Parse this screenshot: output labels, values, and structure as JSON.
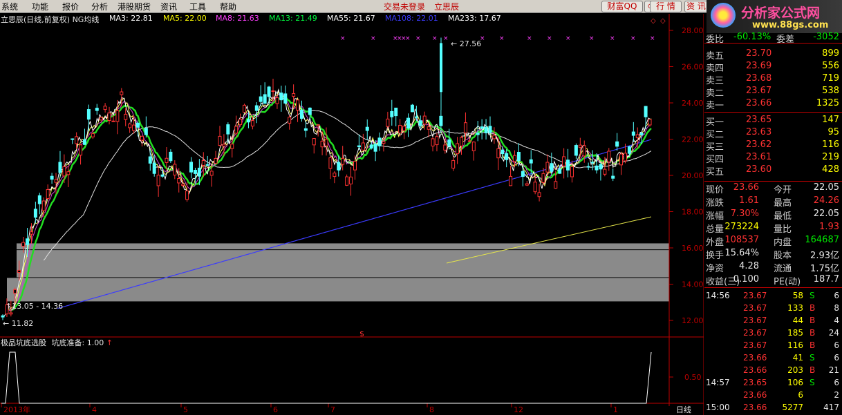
{
  "menu": [
    "系统",
    "功能",
    "报价",
    "分析",
    "港股期货",
    "资讯",
    "工具",
    "帮助"
  ],
  "status_links": [
    "交易未登录",
    "立思辰"
  ],
  "title_buttons": [
    "财富QQ",
    "行 情",
    "资 讯"
  ],
  "logo": {
    "name": "分析家公式网",
    "url": "www.88gs.com"
  },
  "ma_header": {
    "title": "立思辰(日线,前复权) NG均线",
    "items": [
      {
        "label": "MA3: 22.81",
        "color": "#ffffff"
      },
      {
        "label": "MA5: 22.00",
        "color": "#ffff00"
      },
      {
        "label": "MA8: 21.63",
        "color": "#ff40ff"
      },
      {
        "label": "MA13: 21.49",
        "color": "#00ff40"
      },
      {
        "label": "MA55: 21.67",
        "color": "#ffffff"
      },
      {
        "label": "MA108: 22.01",
        "color": "#3b3bff"
      },
      {
        "label": "MA233: 17.67",
        "color": "#ffffff"
      }
    ]
  },
  "indicator": {
    "title": "极品坑底选股",
    "param": "坑底准备: 1.00",
    "scale": "0.50"
  },
  "chart_data": {
    "type": "candlestick",
    "ylim": [
      11,
      28.5
    ],
    "y_ticks": [
      "28.00",
      "26.00",
      "24.00",
      "22.00",
      "20.00",
      "18.00",
      "16.00",
      "14.00",
      "12.00"
    ],
    "x_labels": [
      "2013年",
      "4",
      "5",
      "6",
      "7",
      "8",
      "12",
      "1"
    ],
    "period_label": "日线",
    "annotations": {
      "high": "27.56",
      "low": "11.82",
      "range": "13.05 - 14.36"
    },
    "bands": [
      {
        "from": 13.05,
        "to": 14.36
      },
      {
        "from": 14.36,
        "to": 16.25
      }
    ]
  },
  "panel": {
    "top": [
      {
        "label": "委比",
        "value": "-60.13%",
        "label2": "委差",
        "value2": "-3052"
      }
    ],
    "sells": [
      {
        "label": "卖五",
        "price": "23.70",
        "vol": "899"
      },
      {
        "label": "卖四",
        "price": "23.69",
        "vol": "556"
      },
      {
        "label": "卖三",
        "price": "23.68",
        "vol": "719"
      },
      {
        "label": "卖二",
        "price": "23.67",
        "vol": "538"
      },
      {
        "label": "卖一",
        "price": "23.66",
        "vol": "1325"
      }
    ],
    "buys": [
      {
        "label": "买一",
        "price": "23.65",
        "vol": "147"
      },
      {
        "label": "买二",
        "price": "23.63",
        "vol": "95"
      },
      {
        "label": "买三",
        "price": "23.62",
        "vol": "116"
      },
      {
        "label": "买四",
        "price": "23.61",
        "vol": "219"
      },
      {
        "label": "买五",
        "price": "23.60",
        "vol": "428"
      }
    ],
    "stats": [
      {
        "l1": "现价",
        "v1": "23.66",
        "c1": "red",
        "l2": "今开",
        "v2": "22.05",
        "c2": "wht"
      },
      {
        "l1": "涨跌",
        "v1": "1.61",
        "c1": "red",
        "l2": "最高",
        "v2": "24.26",
        "c2": "red"
      },
      {
        "l1": "涨幅",
        "v1": "7.30%",
        "c1": "red",
        "l2": "最低",
        "v2": "22.05",
        "c2": "wht"
      },
      {
        "l1": "总量",
        "v1": "273224",
        "c1": "yel",
        "l2": "量比",
        "v2": "1.93",
        "c2": "red"
      },
      {
        "l1": "外盘",
        "v1": "108537",
        "c1": "red",
        "l2": "内盘",
        "v2": "164687",
        "c2": "grn"
      },
      {
        "l1": "换手",
        "v1": "15.64%",
        "c1": "wht",
        "l2": "股本",
        "v2": "2.93亿",
        "c2": "wht"
      },
      {
        "l1": "净资",
        "v1": "4.28",
        "c1": "wht",
        "l2": "流通",
        "v2": "1.75亿",
        "c2": "wht"
      },
      {
        "l1": "收益(三)",
        "v1": "0.100",
        "c1": "wht",
        "l2": "PE(动)",
        "v2": "187.7",
        "c2": "wht"
      }
    ],
    "ticks": [
      {
        "time": "14:56",
        "price": "23.67",
        "vol": "58",
        "bs": "S",
        "n": "6"
      },
      {
        "time": "",
        "price": "23.67",
        "vol": "133",
        "bs": "B",
        "n": "8"
      },
      {
        "time": "",
        "price": "23.67",
        "vol": "44",
        "bs": "B",
        "n": "4"
      },
      {
        "time": "",
        "price": "23.67",
        "vol": "185",
        "bs": "B",
        "n": "24"
      },
      {
        "time": "",
        "price": "23.67",
        "vol": "116",
        "bs": "B",
        "n": "6"
      },
      {
        "time": "",
        "price": "23.66",
        "vol": "41",
        "bs": "S",
        "n": "6"
      },
      {
        "time": "",
        "price": "23.66",
        "vol": "203",
        "bs": "B",
        "n": "21"
      },
      {
        "time": "14:57",
        "price": "23.65",
        "vol": "106",
        "bs": "S",
        "n": "6"
      },
      {
        "time": "",
        "price": "23.66",
        "vol": "6",
        "bs": "",
        "n": "2"
      },
      {
        "time": "15:00",
        "price": "23.66",
        "vol": "5277",
        "bs": "",
        "n": "417"
      }
    ]
  }
}
